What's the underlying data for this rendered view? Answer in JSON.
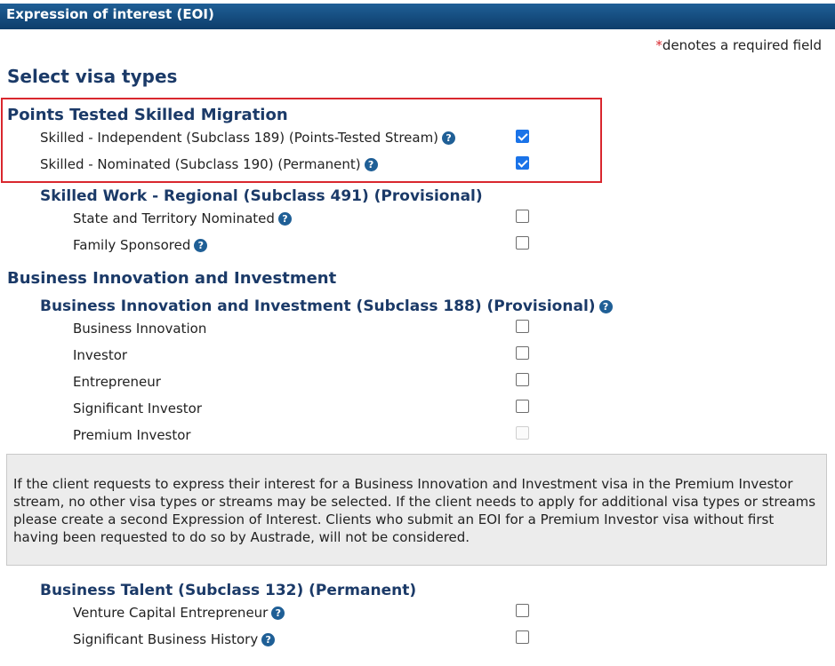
{
  "header": {
    "title": "Expression of interest (EOI)"
  },
  "required_note": {
    "star": "*",
    "text": "denotes a required field"
  },
  "section_title": "Select visa types",
  "groups": {
    "points": {
      "title": "Points Tested Skilled Migration",
      "items": [
        {
          "label": "Skilled - Independent (Subclass 189) (Points-Tested Stream)",
          "checked": true
        },
        {
          "label": "Skilled - Nominated (Subclass 190) (Permanent)",
          "checked": true
        }
      ]
    },
    "regional": {
      "title": "Skilled Work - Regional (Subclass 491) (Provisional)",
      "items": [
        {
          "label": "State and Territory Nominated",
          "checked": false
        },
        {
          "label": "Family Sponsored",
          "checked": false
        }
      ]
    },
    "business": {
      "title": "Business Innovation and Investment",
      "subtitle": "Business Innovation and Investment (Subclass 188) (Provisional)",
      "items": [
        {
          "label": "Business Innovation",
          "checked": false
        },
        {
          "label": "Investor",
          "checked": false
        },
        {
          "label": "Entrepreneur",
          "checked": false
        },
        {
          "label": "Significant Investor",
          "checked": false
        },
        {
          "label": "Premium Investor",
          "checked": false,
          "disabled": true
        }
      ],
      "note": "If the client requests to express their interest for a Business Innovation and Investment visa in the Premium Investor stream, no other visa types or streams may be selected. If the client needs to apply for additional visa types or streams please create a second Expression of Interest. Clients who submit an EOI for a Premium Investor visa without first having been requested to do so by Austrade, will not be considered."
    },
    "talent": {
      "title": "Business Talent (Subclass 132) (Permanent)",
      "items": [
        {
          "label": "Venture Capital Entrepreneur",
          "checked": false
        },
        {
          "label": "Significant Business History",
          "checked": false
        }
      ]
    }
  },
  "help_icon_glyph": "?"
}
